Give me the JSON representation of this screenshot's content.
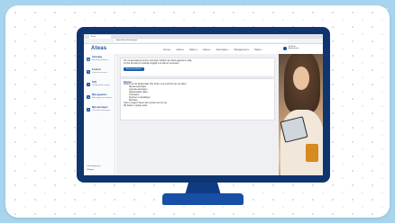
{
  "browser": {
    "tab_title": "Ateas",
    "url": "https://ateas.nl/aanvragen"
  },
  "app": {
    "logo": "Ateas",
    "logo_sub": "",
    "nav": [
      "Home",
      "Admin",
      "Zaken",
      "Cases",
      "Aanvragen",
      "Management",
      "Taken"
    ],
    "user_name": "Mr. Ateas",
    "user_role": "Administrator"
  },
  "sidebar": {
    "items": [
      {
        "title": "Aanvraag",
        "sub": "Aanvraag indienen",
        "icon": "document-icon"
      },
      {
        "title": "Contract",
        "sub": "Contracten inzien",
        "icon": "contract-icon"
      },
      {
        "title": "FAQ",
        "sub": "Veelgestelde vragen",
        "icon": "faq-icon"
      },
      {
        "title": "Mijn gegevens",
        "sub": "Mijn gegevens beheren",
        "icon": "user-icon"
      },
      {
        "title": "Mijn aanvragen",
        "sub": "Overzicht aanvragen",
        "icon": "list-icon"
      }
    ],
    "footer_link": "Contactgegevens",
    "footer_text": "Uitloggen"
  },
  "main": {
    "intro_line1": "Om uw aanvraag te kunnen verwerken hebben wij enkele gegevens nodig.",
    "intro_line2": "Vul het formulier zo volledig mogelijk in en klik op verzenden.",
    "button_label": "Aanvraag indienen",
    "info_title": "Nieuws",
    "info_intro": "Welkom op het klantportaal. Hier vindt u een overzicht van uw zaken.",
    "info_items": [
      "Nieuwe aanvragen",
      "Lopende aanvragen",
      "Afgehandelde zaken",
      "Contracten",
      "Facturen en betalingen",
      "Berichten"
    ],
    "info_footer1": "Heeft u vragen? Neem dan contact met ons op.",
    "info_footer2": "Wij helpen u graag verder."
  },
  "colors": {
    "background": "#a8d4ed",
    "monitor": "#0f3570",
    "accent": "#1d4f9c"
  }
}
